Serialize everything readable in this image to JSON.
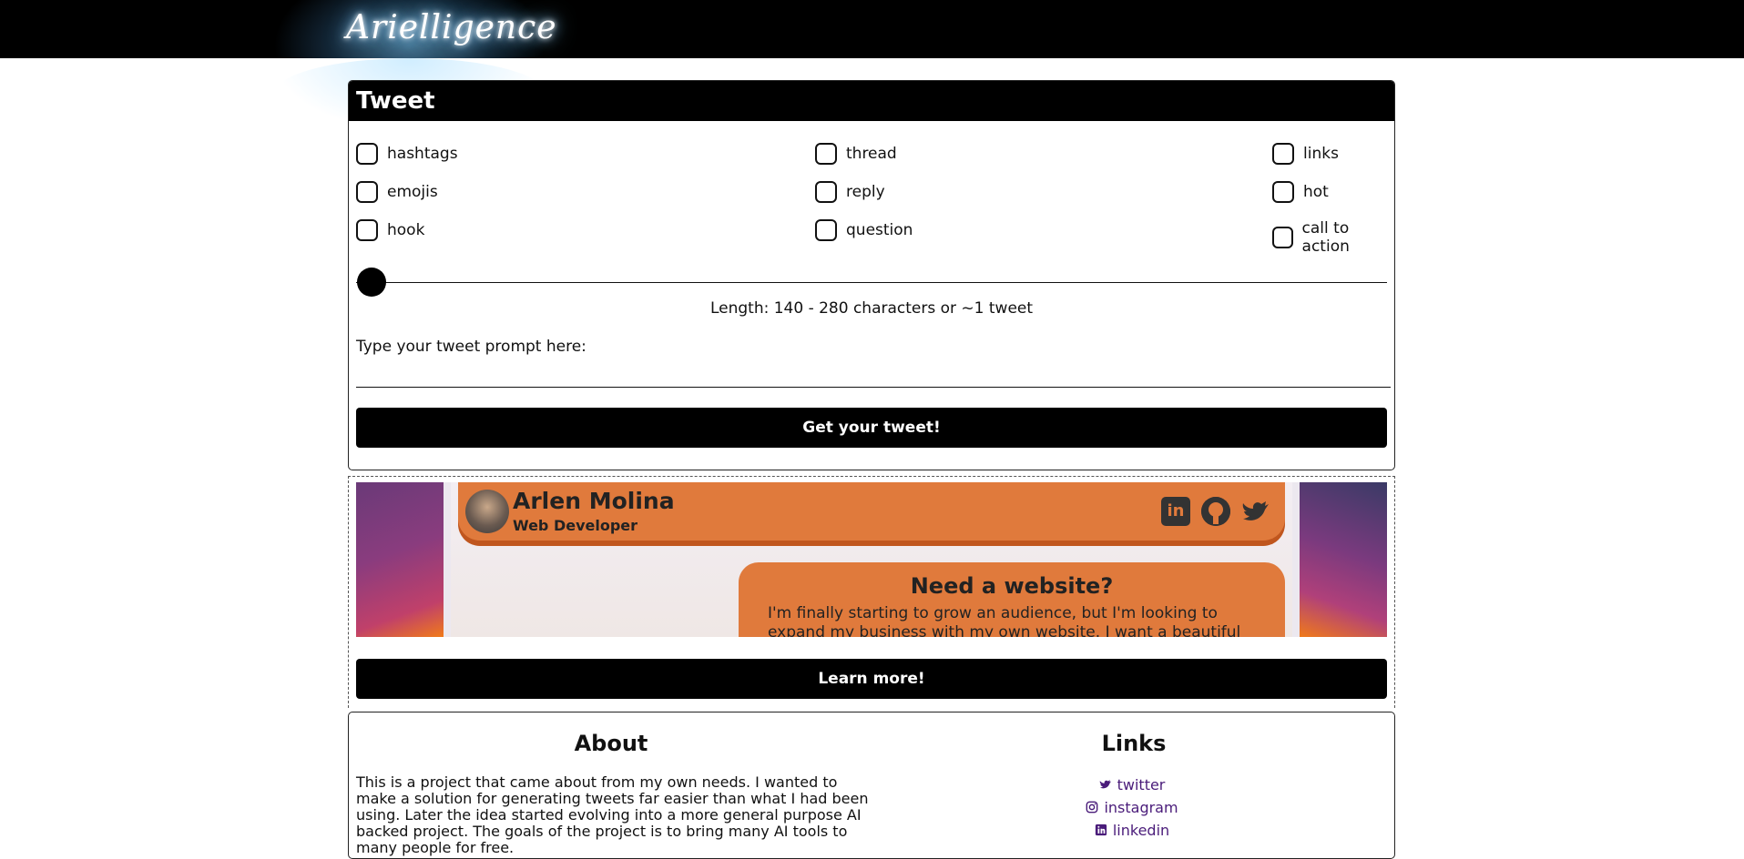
{
  "header": {
    "logo_text": "Arielligence"
  },
  "tweet": {
    "title": "Tweet",
    "options": [
      {
        "label": "hashtags"
      },
      {
        "label": "thread"
      },
      {
        "label": "links"
      },
      {
        "label": "emojis"
      },
      {
        "label": "reply"
      },
      {
        "label": "hot"
      },
      {
        "label": "hook"
      },
      {
        "label": "question"
      },
      {
        "label": "call to action"
      }
    ],
    "slider_value": 0,
    "length_text": "Length: 140 - 280 characters or ~1 tweet",
    "prompt_label": "Type your tweet prompt here:",
    "prompt_value": "",
    "submit_label": "Get your tweet!"
  },
  "ad": {
    "name": "Arlen Molina",
    "role": "Web Developer",
    "social": [
      "linkedin-icon",
      "github-icon",
      "twitter-icon"
    ],
    "promo_title": "Need a website?",
    "promo_text": "I'm finally starting to grow an audience, but I'm looking to expand my business with my own website. I want a beautiful site, that",
    "learn_label": "Learn more!"
  },
  "about": {
    "title": "About",
    "text": "This is a project that came about from my own needs. I wanted to make a solution for generating tweets far easier than what I had been using. Later the idea started evolving into a more general purpose AI backed project. The goals of the project is to bring many AI tools to many people for free."
  },
  "links": {
    "title": "Links",
    "items": [
      {
        "label": "twitter",
        "icon": "twitter-icon"
      },
      {
        "label": "instagram",
        "icon": "instagram-icon"
      },
      {
        "label": "linkedin",
        "icon": "linkedin-icon"
      }
    ],
    "color": "#4a1c7a"
  }
}
